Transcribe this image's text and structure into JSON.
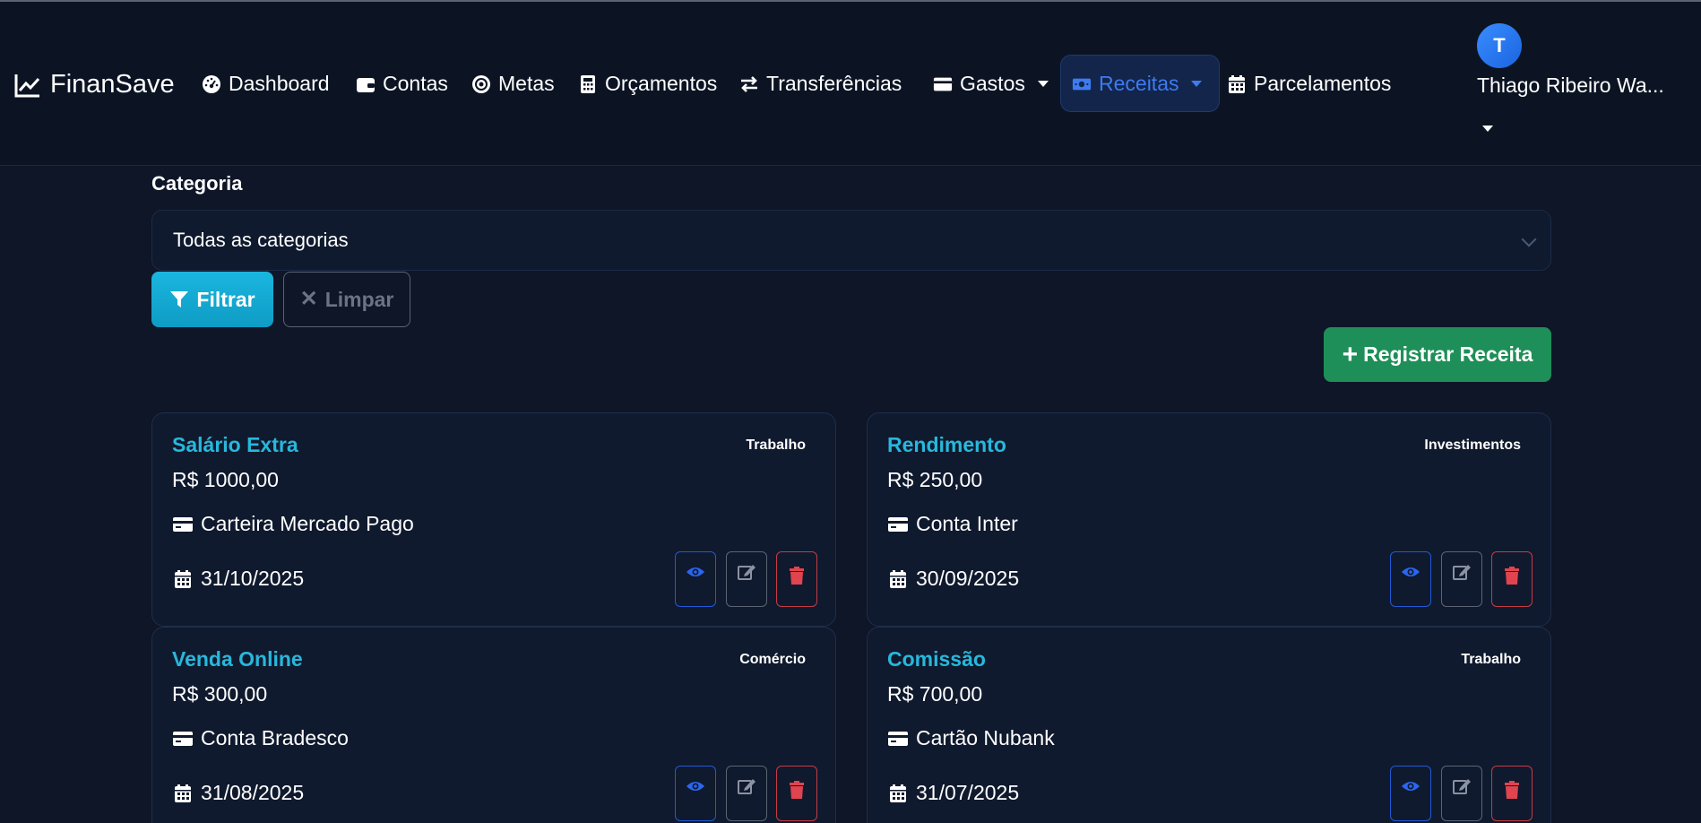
{
  "app": {
    "brand": "FinanSave"
  },
  "nav": {
    "items": [
      {
        "label": "Dashboard",
        "icon": "gauge-icon"
      },
      {
        "label": "Contas",
        "icon": "wallet-icon"
      },
      {
        "label": "Metas",
        "icon": "target-icon"
      },
      {
        "label": "Orçamentos",
        "icon": "calculator-icon"
      },
      {
        "label": "Transferências",
        "icon": "exchange-icon"
      },
      {
        "label": "Gastos",
        "icon": "credit-card-icon",
        "dropdown": true
      },
      {
        "label": "Receitas",
        "icon": "money-bill-icon",
        "dropdown": true,
        "active": true
      },
      {
        "label": "Parcelamentos",
        "icon": "calendar-icon"
      }
    ],
    "active_color": "#3d7bf0"
  },
  "user": {
    "initial": "T",
    "name": "Thiago Ribeiro Wa..."
  },
  "filter": {
    "category_label": "Categoria",
    "category_value": "Todas as categorias",
    "filter_button": "Filtrar",
    "clear_button": "Limpar"
  },
  "actions": {
    "register_button": "Registrar Receita"
  },
  "cards": [
    {
      "title": "Salário Extra",
      "category": "Trabalho",
      "amount": "R$ 1000,00",
      "account": "Carteira Mercado Pago",
      "date": "31/10/2025"
    },
    {
      "title": "Rendimento",
      "category": "Investimentos",
      "amount": "R$ 250,00",
      "account": "Conta Inter",
      "date": "30/09/2025"
    },
    {
      "title": "Venda Online",
      "category": "Comércio",
      "amount": "R$ 300,00",
      "account": "Conta Bradesco",
      "date": "31/08/2025"
    },
    {
      "title": "Comissão",
      "category": "Trabalho",
      "amount": "R$ 700,00",
      "account": "Cartão Nubank",
      "date": "31/07/2025"
    }
  ],
  "colors": {
    "background": "#0e1627",
    "title_accent": "#27b8dc",
    "filter_button": "#15a9d3",
    "register_button": "#1e8f58",
    "view": "#2358d6",
    "delete": "#c73a44"
  }
}
